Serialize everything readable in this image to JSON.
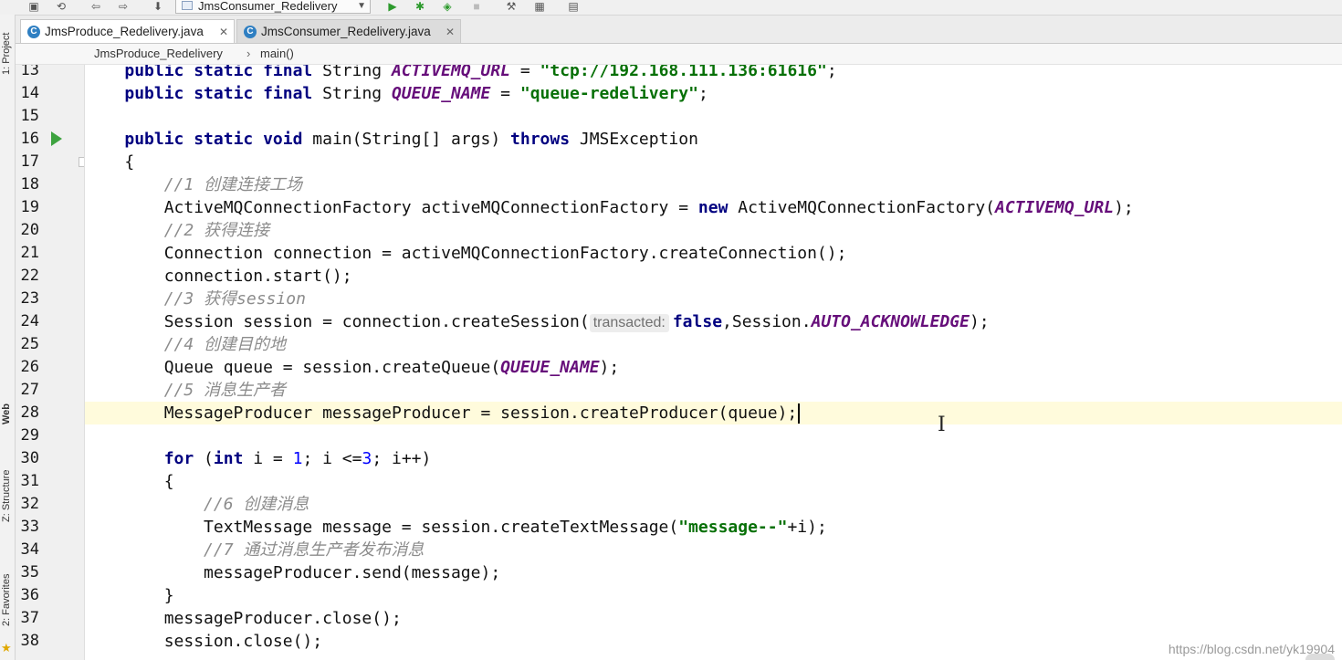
{
  "toolbar": {
    "run_config_label": "JmsConsumer_Redelivery",
    "icons": [
      "save-icon",
      "sync-icon",
      "back-icon",
      "forward-icon",
      "build-icon",
      "run-icon",
      "debug-icon",
      "coverage-icon",
      "stop-icon",
      "project-structure-icon",
      "sdk-icon",
      "terminal-icon"
    ]
  },
  "left_strip": {
    "project_tab": "1: Project",
    "web_tab": "Web",
    "structure_tab": "Z: Structure",
    "favorites_tab": "2: Favorites"
  },
  "tabs": [
    {
      "label": "JmsProduce_Redelivery.java",
      "active": true
    },
    {
      "label": "JmsConsumer_Redelivery.java",
      "active": false
    }
  ],
  "breadcrumb": {
    "class_name": "JmsProduce_Redelivery",
    "separator": "›",
    "method": "main()"
  },
  "editor": {
    "caret_line": 28,
    "lines": [
      {
        "n": "13",
        "t": [
          [
            "    ",
            ""
          ],
          [
            "public static final",
            "kw"
          ],
          [
            " String ",
            ""
          ],
          [
            "ACTIVEMQ_URL",
            "cst"
          ],
          [
            " = ",
            ""
          ],
          [
            "\"tcp://192.168.111.136:61616\"",
            "str"
          ],
          [
            ";",
            ""
          ]
        ]
      },
      {
        "n": "14",
        "t": [
          [
            "    ",
            ""
          ],
          [
            "public static final",
            "kw"
          ],
          [
            " String ",
            ""
          ],
          [
            "QUEUE_NAME",
            "cst"
          ],
          [
            " = ",
            ""
          ],
          [
            "\"queue-redelivery\"",
            "str"
          ],
          [
            ";",
            ""
          ]
        ]
      },
      {
        "n": "15",
        "t": []
      },
      {
        "n": "16",
        "t": [
          [
            "    ",
            ""
          ],
          [
            "public static void",
            "kw"
          ],
          [
            " main(String[] args) ",
            ""
          ],
          [
            "throws",
            "kw"
          ],
          [
            " JMSException",
            ""
          ]
        ]
      },
      {
        "n": "17",
        "t": [
          [
            "    {",
            ""
          ]
        ]
      },
      {
        "n": "18",
        "t": [
          [
            "        ",
            ""
          ],
          [
            "//1 创建连接工场",
            "cmt"
          ]
        ]
      },
      {
        "n": "19",
        "t": [
          [
            "        ActiveMQConnectionFactory activeMQConnectionFactory = ",
            ""
          ],
          [
            "new",
            "kw"
          ],
          [
            " ActiveMQConnectionFactory(",
            ""
          ],
          [
            "ACTIVEMQ_URL",
            "cst"
          ],
          [
            ");",
            ""
          ]
        ]
      },
      {
        "n": "20",
        "t": [
          [
            "        ",
            ""
          ],
          [
            "//2 获得连接",
            "cmt"
          ]
        ]
      },
      {
        "n": "21",
        "t": [
          [
            "        Connection connection = activeMQConnectionFactory.createConnection();",
            ""
          ]
        ]
      },
      {
        "n": "22",
        "t": [
          [
            "        connection.start();",
            ""
          ]
        ]
      },
      {
        "n": "23",
        "t": [
          [
            "        ",
            ""
          ],
          [
            "//3 获得session",
            "cmt"
          ]
        ]
      },
      {
        "n": "24",
        "t": [
          [
            "        Session session = connection.createSession(",
            ""
          ],
          [
            "transacted:",
            "hint"
          ],
          [
            "false",
            "kw"
          ],
          [
            ",Session.",
            ""
          ],
          [
            "AUTO_ACKNOWLEDGE",
            "cst"
          ],
          [
            ");",
            ""
          ]
        ]
      },
      {
        "n": "25",
        "t": [
          [
            "        ",
            ""
          ],
          [
            "//4 创建目的地",
            "cmt"
          ]
        ]
      },
      {
        "n": "26",
        "t": [
          [
            "        Queue queue = session.createQueue(",
            ""
          ],
          [
            "QUEUE_NAME",
            "cst"
          ],
          [
            ");",
            ""
          ]
        ]
      },
      {
        "n": "27",
        "t": [
          [
            "        ",
            ""
          ],
          [
            "//5 消息生产者",
            "cmt"
          ]
        ]
      },
      {
        "n": "28",
        "t": [
          [
            "        MessageProducer messageProducer = session.createProducer(queue);",
            ""
          ]
        ]
      },
      {
        "n": "29",
        "t": []
      },
      {
        "n": "30",
        "t": [
          [
            "        ",
            ""
          ],
          [
            "for",
            "kw"
          ],
          [
            " (",
            ""
          ],
          [
            "int",
            "kw"
          ],
          [
            " i = ",
            ""
          ],
          [
            "1",
            "num"
          ],
          [
            "; i <=",
            ""
          ],
          [
            "3",
            "num"
          ],
          [
            "; i++)",
            ""
          ]
        ]
      },
      {
        "n": "31",
        "t": [
          [
            "        {",
            ""
          ]
        ]
      },
      {
        "n": "32",
        "t": [
          [
            "            ",
            ""
          ],
          [
            "//6 创建消息",
            "cmt"
          ]
        ]
      },
      {
        "n": "33",
        "t": [
          [
            "            TextMessage message = session.createTextMessage(",
            ""
          ],
          [
            "\"message--\"",
            "str"
          ],
          [
            "+i);",
            ""
          ]
        ]
      },
      {
        "n": "34",
        "t": [
          [
            "            ",
            ""
          ],
          [
            "//7 通过消息生产者发布消息",
            "cmt"
          ]
        ]
      },
      {
        "n": "35",
        "t": [
          [
            "            messageProducer.send(message);",
            ""
          ]
        ]
      },
      {
        "n": "36",
        "t": [
          [
            "        }",
            ""
          ]
        ]
      },
      {
        "n": "37",
        "t": [
          [
            "        messageProducer.close();",
            ""
          ]
        ]
      },
      {
        "n": "38",
        "t": [
          [
            "        session.close();",
            ""
          ]
        ]
      }
    ]
  },
  "watermark": "https://blog.csdn.net/yk19904"
}
